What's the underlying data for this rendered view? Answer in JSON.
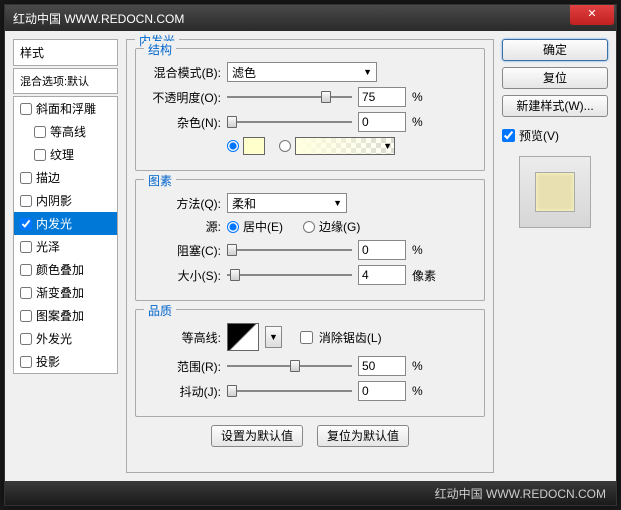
{
  "titlebar": {
    "text": "红动中国 WWW.REDOCN.COM",
    "close": "✕"
  },
  "left": {
    "styles_label": "样式",
    "blend_label": "混合选项:默认",
    "items": [
      {
        "label": "斜面和浮雕",
        "checked": false,
        "sub": false
      },
      {
        "label": "等高线",
        "checked": false,
        "sub": true
      },
      {
        "label": "纹理",
        "checked": false,
        "sub": true
      },
      {
        "label": "描边",
        "checked": false,
        "sub": false
      },
      {
        "label": "内阴影",
        "checked": false,
        "sub": false
      },
      {
        "label": "内发光",
        "checked": true,
        "sub": false,
        "selected": true
      },
      {
        "label": "光泽",
        "checked": false,
        "sub": false
      },
      {
        "label": "颜色叠加",
        "checked": false,
        "sub": false
      },
      {
        "label": "渐变叠加",
        "checked": false,
        "sub": false
      },
      {
        "label": "图案叠加",
        "checked": false,
        "sub": false
      },
      {
        "label": "外发光",
        "checked": false,
        "sub": false
      },
      {
        "label": "投影",
        "checked": false,
        "sub": false
      }
    ]
  },
  "center": {
    "outer_title": "内发光",
    "struct": {
      "title": "结构",
      "blend_mode_label": "混合模式(B):",
      "blend_mode_value": "滤色",
      "opacity_label": "不透明度(O):",
      "opacity_value": "75",
      "noise_label": "杂色(N):",
      "noise_value": "0",
      "pct": "%",
      "color": "#ffffcc"
    },
    "elem": {
      "title": "图素",
      "technique_label": "方法(Q):",
      "technique_value": "柔和",
      "source_label": "源:",
      "center_label": "居中(E)",
      "edge_label": "边缘(G)",
      "choke_label": "阻塞(C):",
      "choke_value": "0",
      "size_label": "大小(S):",
      "size_value": "4",
      "pct": "%",
      "px": "像素"
    },
    "qual": {
      "title": "品质",
      "contour_label": "等高线:",
      "antialias_label": "消除锯齿(L)",
      "range_label": "范围(R):",
      "range_value": "50",
      "jitter_label": "抖动(J):",
      "jitter_value": "0",
      "pct": "%"
    },
    "buttons": {
      "default": "设置为默认值",
      "reset": "复位为默认值"
    }
  },
  "right": {
    "ok": "确定",
    "cancel": "复位",
    "new_style": "新建样式(W)...",
    "preview_label": "预览(V)"
  },
  "footer": {
    "text": "红动中国 WWW.REDOCN.COM"
  }
}
